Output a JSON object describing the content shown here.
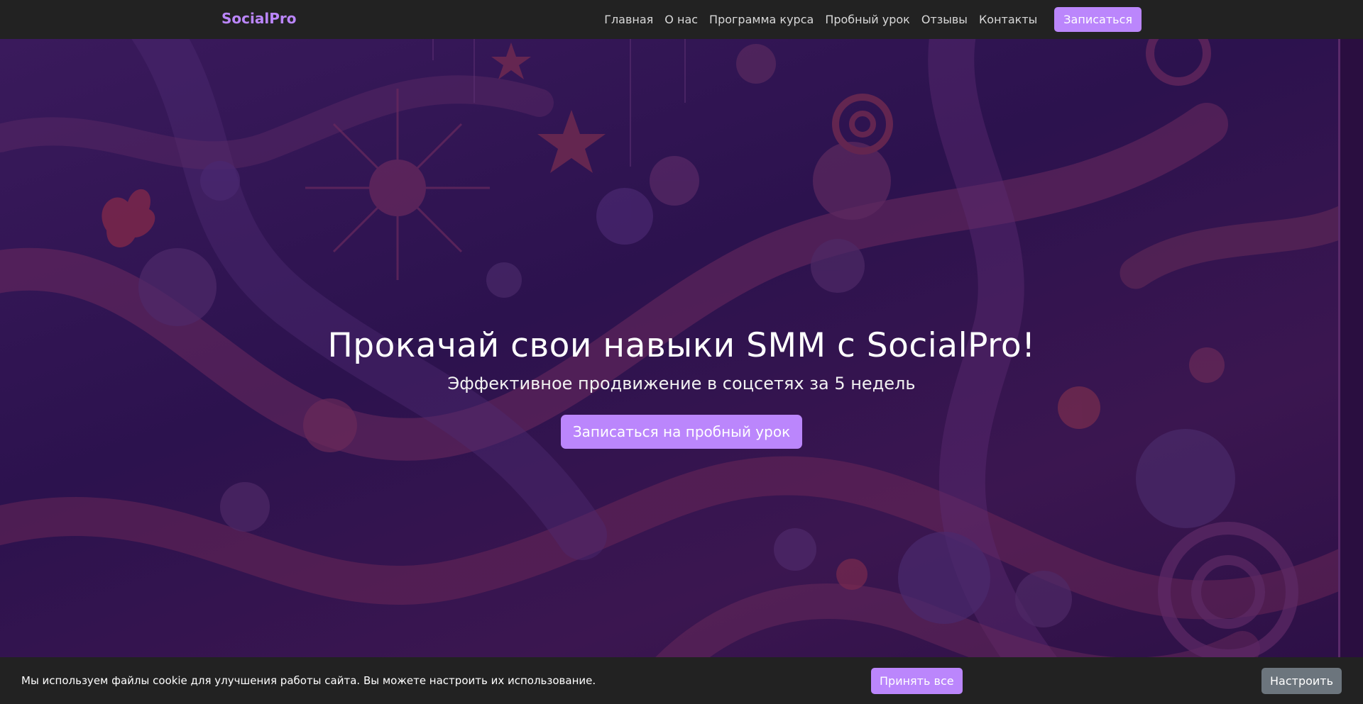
{
  "brand": "SocialPro",
  "nav": {
    "links": [
      "Главная",
      "О нас",
      "Программа курса",
      "Пробный урок",
      "Отзывы",
      "Контакты"
    ],
    "cta": "Записаться"
  },
  "hero": {
    "title": "Прокачай свои навыки SMM с SocialPro!",
    "subtitle": "Эффективное продвижение в соцсетях за 5 недель",
    "cta": "Записаться на пробный урок"
  },
  "cookie": {
    "text": "Мы используем файлы cookie для улучшения работы сайта. Вы можете настроить их использование.",
    "accept": "Принять все",
    "settings": "Настроить"
  },
  "colors": {
    "accent": "#bb86fc",
    "navbar": "#222222",
    "secondary_button": "#6c757d",
    "hero_base": "#2c124e"
  }
}
